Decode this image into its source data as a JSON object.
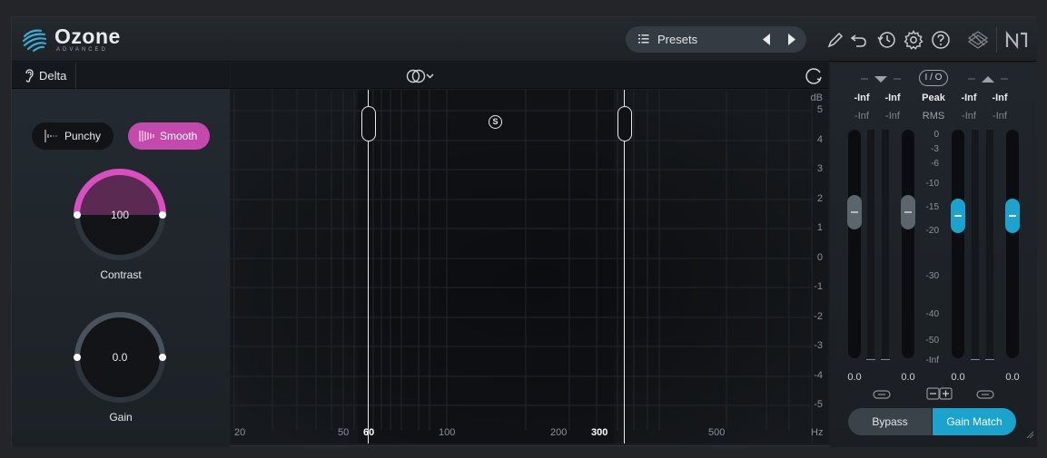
{
  "header": {
    "logo": "Ozone",
    "logo_sub": "ADVANCED",
    "presets_label": "Presets"
  },
  "toolbar": {
    "delta_label": "Delta"
  },
  "modes": {
    "punchy_label": "Punchy",
    "smooth_label": "Smooth",
    "active": "Smooth"
  },
  "contrast": {
    "value": "100",
    "label": "Contrast",
    "fill_fraction": 1.0
  },
  "gain": {
    "value": "0.0",
    "label": "Gain"
  },
  "graph": {
    "db_unit": "dB",
    "db_ticks": [
      "5",
      "4",
      "3",
      "2",
      "1",
      "0",
      "-1",
      "-2",
      "-3",
      "-4",
      "-5"
    ],
    "freq_ticks": [
      "20",
      "50",
      "60",
      "100",
      "200",
      "300",
      "500",
      "Hz"
    ],
    "band_low": "60",
    "band_high": "300",
    "solo_label": "S"
  },
  "meters": {
    "io_label": "I / O",
    "peak_label": "Peak",
    "rms_label": "RMS",
    "input_peak": [
      "-Inf",
      "-Inf"
    ],
    "input_rms": [
      "-Inf",
      "-Inf"
    ],
    "output_peak": [
      "-Inf",
      "-Inf"
    ],
    "output_rms": [
      "-Inf",
      "-Inf"
    ],
    "scale": [
      "0",
      "-3",
      "-6",
      "-10",
      "-15",
      "-20",
      "-30",
      "-40",
      "-50",
      "-Inf"
    ],
    "fader_values": [
      "0.0",
      "0.0",
      "0.0",
      "0.0"
    ],
    "bypass_label": "Bypass",
    "gain_match_label": "Gain Match"
  },
  "colors": {
    "accent_pink": "#c34aac",
    "accent_blue": "#1aa3cc"
  }
}
